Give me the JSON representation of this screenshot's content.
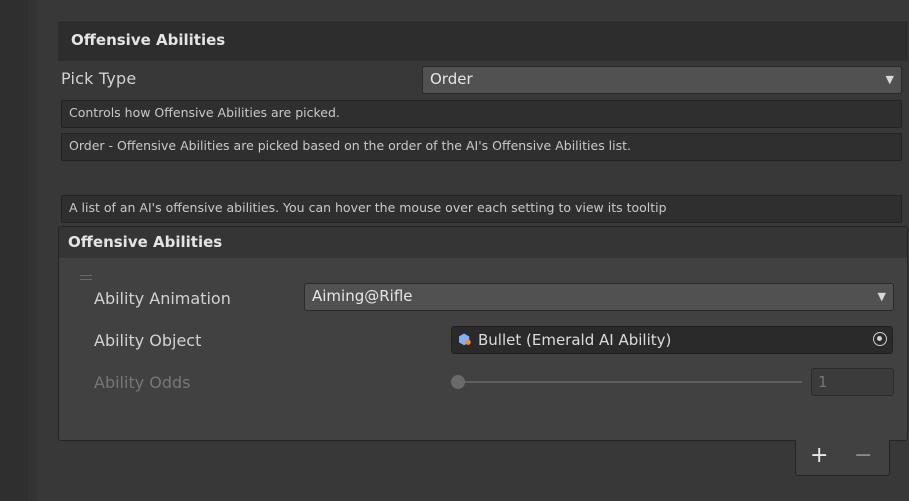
{
  "section": {
    "title": "Offensive Abilities"
  },
  "pick_type": {
    "label": "Pick Type",
    "value": "Order"
  },
  "help": {
    "controls": "Controls how Offensive Abilities are picked.",
    "order": "Order - Offensive Abilities are picked based on the order of the AI's Offensive Abilities list.",
    "list_info": "A list of an AI's offensive abilities. You can hover the mouse over each setting to view its tooltip"
  },
  "list": {
    "title": "Offensive Abilities",
    "items": [
      {
        "ability_animation": {
          "label": "Ability Animation",
          "value": "Aiming@Rifle"
        },
        "ability_object": {
          "label": "Ability Object",
          "value": "Bullet (Emerald AI Ability)",
          "icon": "ability-object-icon"
        },
        "ability_odds": {
          "label": "Ability Odds",
          "value": "1",
          "slider_fraction": 0.0
        }
      }
    ],
    "footer": {
      "add_label": "+",
      "remove_label": "−"
    }
  },
  "colors": {
    "background": "#383838",
    "dropdown": "#515151",
    "helpbox": "#2f2f2f",
    "list_body": "#414141"
  }
}
